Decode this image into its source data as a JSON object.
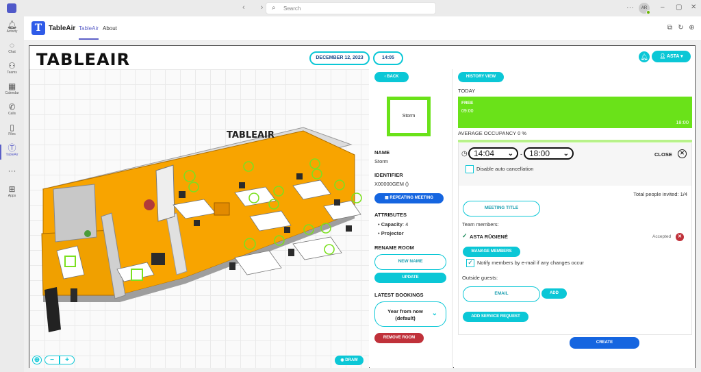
{
  "titlebar": {
    "search_placeholder": "Search",
    "avatar_initials": "AR"
  },
  "rail": {
    "items": [
      {
        "label": "Activity",
        "icon": "bell-icon"
      },
      {
        "label": "Chat",
        "icon": "chat-icon"
      },
      {
        "label": "Teams",
        "icon": "teams-icon"
      },
      {
        "label": "Calendar",
        "icon": "calendar-icon"
      },
      {
        "label": "Calls",
        "icon": "phone-icon"
      },
      {
        "label": "Files",
        "icon": "file-icon"
      },
      {
        "label": "TableAir",
        "icon": "tableair-icon"
      },
      {
        "label": "Apps",
        "icon": "apps-icon"
      }
    ]
  },
  "app": {
    "icon_letter": "T",
    "name": "TableAir",
    "tabs": [
      "TableAir",
      "About"
    ]
  },
  "topbar": {
    "logo": "TABLEAIR",
    "date": "DECEMBER 12, 2023",
    "time": "14:05",
    "user": "ASTA"
  },
  "floorplan": {
    "wall_logo": "TABLEAIR",
    "draw_label": "DRAW",
    "floor_color": "#f8a400",
    "desk_ring_color": "#7be01f"
  },
  "room": {
    "back_label": "BACK",
    "preview_name": "Storm",
    "name_heading": "NAME",
    "name_value": "Storm",
    "identifier_heading": "IDENTIFIER",
    "identifier_value": "X00000GEM ()",
    "repeating_label": "REPEATING MEETING",
    "attributes_heading": "ATTRIBUTES",
    "attributes": [
      {
        "key": "Capacity",
        "value": ": 4"
      },
      {
        "key": "Projector",
        "value": ""
      }
    ],
    "rename_heading": "RENAME ROOM",
    "new_name_placeholder": "NEW NAME",
    "update_label": "UPDATE",
    "latest_heading": "LATEST BOOKINGS",
    "latest_select": "Year from now (default)",
    "remove_label": "REMOVE ROOM"
  },
  "booking": {
    "history_label": "HISTORY VIEW",
    "today": "TODAY",
    "free_label": "FREE",
    "free_start": "09:00",
    "free_end": "18:00",
    "avg_occupancy": "AVERAGE OCCUPANCY 0 %",
    "time_from": "14:04",
    "time_to": "18:00",
    "close_label": "CLOSE",
    "disable_auto": "Disable auto cancellation",
    "total_invited": "Total people invited: 1/4",
    "meeting_title_placeholder": "MEETING TITLE",
    "team_members_label": "Team members:",
    "member_name": "ASTA RŪGIENĖ",
    "member_status": "Accepted",
    "manage_members": "MANAGE MEMBERS",
    "notify_label": "Notify members by e-mail if any changes occur",
    "outside_guests": "Outside guests:",
    "email_placeholder": "EMAIL",
    "add_label": "ADD",
    "service_request": "ADD SERVICE REQUEST",
    "create_label": "CREATE"
  }
}
